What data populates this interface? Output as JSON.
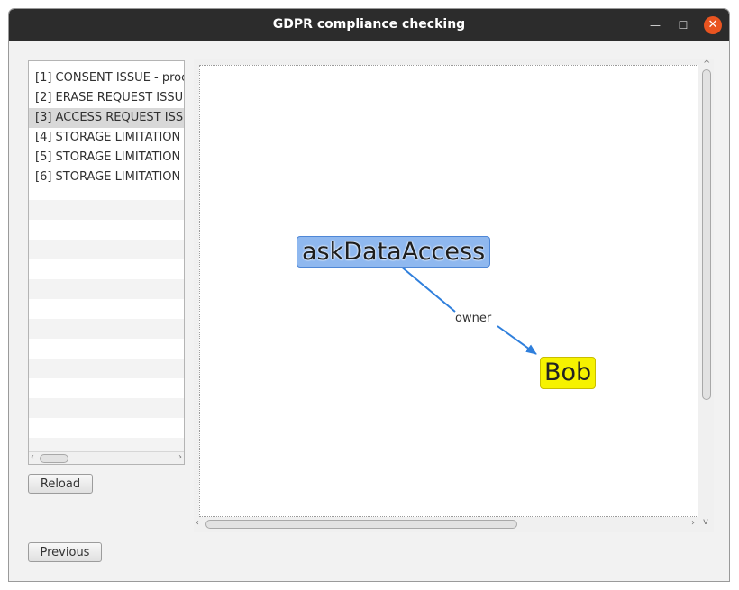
{
  "window": {
    "title": "GDPR compliance checking",
    "minimize_glyph": "—",
    "maximize_glyph": "☐",
    "close_glyph": "✕"
  },
  "issues": {
    "items": [
      {
        "label": "[1] CONSENT ISSUE - proc"
      },
      {
        "label": "[2] ERASE REQUEST ISSU"
      },
      {
        "label": "[3] ACCESS REQUEST ISS",
        "selected": true
      },
      {
        "label": "[4] STORAGE LIMITATION"
      },
      {
        "label": "[5] STORAGE LIMITATION"
      },
      {
        "label": "[6] STORAGE LIMITATION"
      }
    ]
  },
  "buttons": {
    "reload": "Reload",
    "previous": "Previous"
  },
  "graph": {
    "nodes": {
      "ask": "askDataAccess",
      "bob": "Bob"
    },
    "edge": {
      "label": "owner"
    },
    "colors": {
      "ask_fill": "#8fb8ef",
      "bob_fill": "#f6f200",
      "edge": "#2f7fdc"
    }
  },
  "icons": {
    "left_arrow": "‹",
    "right_arrow": "›",
    "up_arrow": "^",
    "down_arrow": "v"
  }
}
